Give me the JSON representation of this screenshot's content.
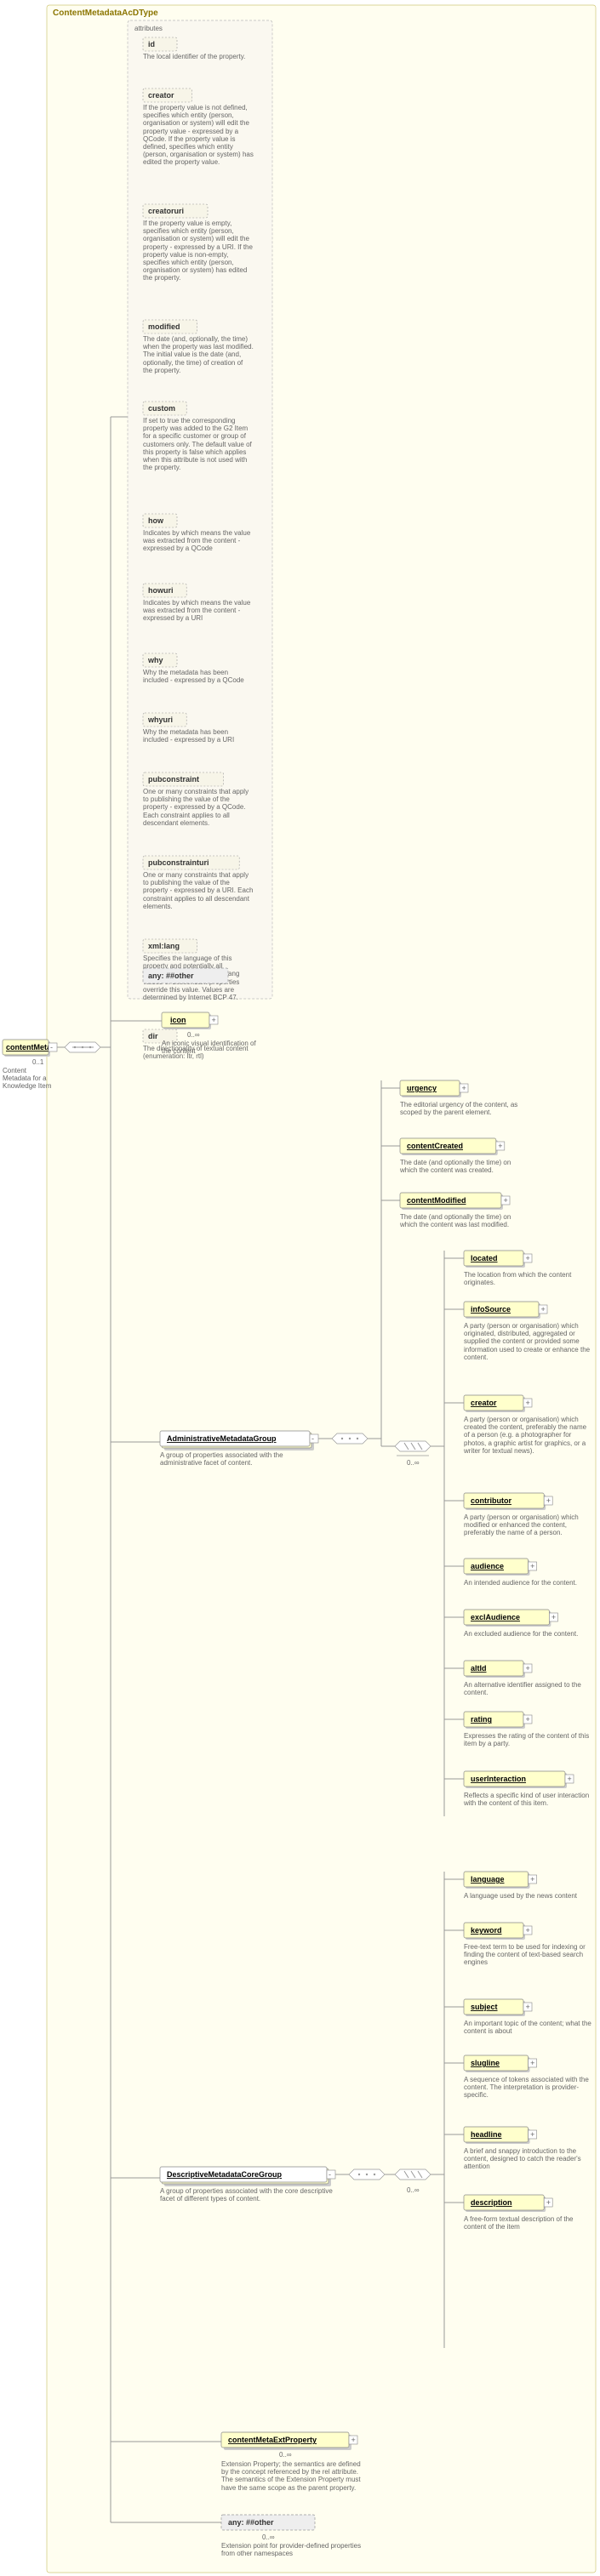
{
  "root": {
    "typeName": "ContentMetadataAcDType",
    "element": {
      "name": "contentMeta",
      "card": "0..1",
      "desc": "Content Metadata for a Knowledge Item"
    },
    "attributesLabel": "attributes",
    "attributes": [
      {
        "name": "id",
        "desc": "The local identifier of the property."
      },
      {
        "name": "creator",
        "desc": "If the property value is not defined, specifies which entity (person, organisation or system) will edit the property value - expressed by a QCode. If the property value is defined, specifies which entity (person, organisation or system) has edited the property value."
      },
      {
        "name": "creatoruri",
        "desc": "If the property value is empty, specifies which entity (person, organisation or system) will edit the property - expressed by a URI. If the property value is non-empty, specifies which entity (person, organisation or system) has edited the property."
      },
      {
        "name": "modified",
        "desc": "The date (and, optionally, the time) when the property was last modified. The initial value is the date (and, optionally, the time) of creation of the property."
      },
      {
        "name": "custom",
        "desc": "If set to true the corresponding property was added to the G2 Item for a specific customer or group of customers only. The default value of this property is false which applies when this attribute is not used with the property."
      },
      {
        "name": "how",
        "desc": "Indicates by which means the value was extracted from the content - expressed by a QCode"
      },
      {
        "name": "howuri",
        "desc": "Indicates by which means the value was extracted from the content - expressed by a URI"
      },
      {
        "name": "why",
        "desc": "Why the metadata has been included - expressed by a QCode"
      },
      {
        "name": "whyuri",
        "desc": "Why the metadata has been included - expressed by a URI"
      },
      {
        "name": "pubconstraint",
        "desc": "One or many constraints that apply to publishing the value of the property - expressed by a QCode. Each constraint applies to all descendant elements."
      },
      {
        "name": "pubconstrainturi",
        "desc": "One or many constraints that apply to publishing the value of the property - expressed by a URI. Each constraint applies to all descendant elements."
      },
      {
        "name": "xml:lang",
        "desc": "Specifies the language of this property and potentially all descendant properties. xml:lang values of descendant properties override this value. Values are determined by Internet BCP 47."
      },
      {
        "name": "dir",
        "desc": "The directionality of textual content (enumeration: ltr, rtl)"
      }
    ],
    "anyOther": "any: ##other",
    "children": {
      "icon": {
        "name": "icon",
        "card": "0..∞",
        "desc": "An iconic visual identification of the content"
      },
      "adminGroup": {
        "name": "AdministrativeMetadataGroup",
        "desc": "A group of properties associated with the administrative facet of content.",
        "headerItems": [
          {
            "name": "urgency",
            "desc": "The editorial urgency of the content, as scoped by the parent element."
          },
          {
            "name": "contentCreated",
            "desc": "The date (and optionally the time) on which the content was created."
          },
          {
            "name": "contentModified",
            "desc": "The date (and optionally the time) on which the content was last modified."
          }
        ],
        "repeatingCard": "0..∞",
        "repeatingItems": [
          {
            "name": "located",
            "desc": "The location from which the content originates."
          },
          {
            "name": "infoSource",
            "desc": "A party (person or organisation) which originated, distributed, aggregated or supplied the content or provided some information used to create or enhance the content."
          },
          {
            "name": "creator",
            "desc": "A party (person or organisation) which created the content, preferably the name of a person (e.g. a photographer for photos, a graphic artist for graphics, or a writer for textual news)."
          },
          {
            "name": "contributor",
            "desc": "A party (person or organisation) which modified or enhanced the content, preferably the name of a person."
          },
          {
            "name": "audience",
            "desc": "An intended audience for the content."
          },
          {
            "name": "exclAudience",
            "desc": "An excluded audience for the content."
          },
          {
            "name": "altId",
            "desc": "An alternative identifier assigned to the content."
          },
          {
            "name": "rating",
            "desc": "Expresses the rating of the content of this item by a party."
          },
          {
            "name": "userInteraction",
            "desc": "Reflects a specific kind of user interaction with the content of this item."
          }
        ]
      },
      "descGroup": {
        "name": "DescriptiveMetadataCoreGroup",
        "desc": "A group of properties associated with the core descriptive facet of different types of content.",
        "card": "0..∞",
        "items": [
          {
            "name": "language",
            "desc": "A language used by the news content"
          },
          {
            "name": "keyword",
            "desc": "Free-text term to be used for indexing or finding the content of text-based search engines"
          },
          {
            "name": "subject",
            "desc": "An important topic of the content; what the content is about"
          },
          {
            "name": "slugline",
            "desc": "A sequence of tokens associated with the content. The interpretation is provider-specific."
          },
          {
            "name": "headline",
            "desc": "A brief and snappy introduction to the content, designed to catch the reader's attention"
          },
          {
            "name": "description",
            "desc": "A free-form textual description of the content of the item"
          }
        ]
      },
      "extProp": {
        "name": "contentMetaExtProperty",
        "card": "0..∞",
        "desc": "Extension Property; the semantics are defined by the concept referenced by the rel attribute. The semantics of the Extension Property must have the same scope as the parent property."
      },
      "anyBlock": {
        "label": "any: ##other",
        "card": "0..∞",
        "desc": "Extension point for provider-defined properties from other namespaces"
      }
    }
  }
}
